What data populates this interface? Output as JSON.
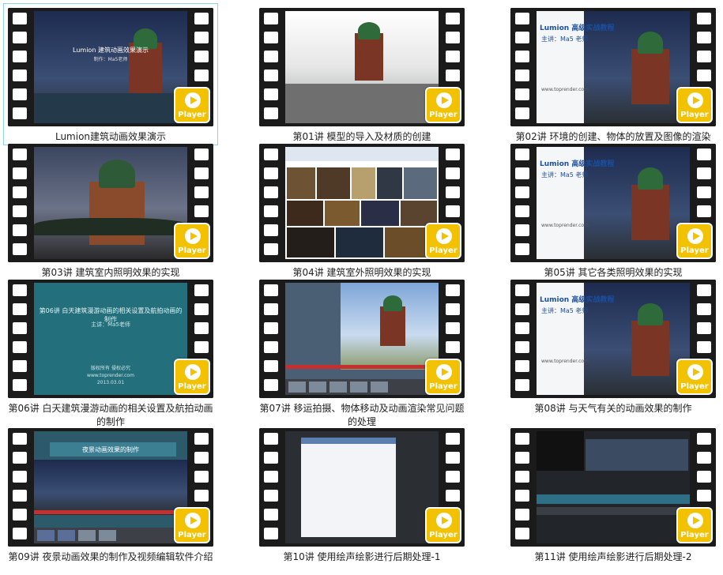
{
  "player_label": "Player",
  "brand_color": "#f2c200",
  "videos": [
    {
      "caption": "Lumion建筑动画效果演示",
      "screen_title": "Lumion 建筑动画效果演示",
      "screen_sub": "制作：Ma5老师"
    },
    {
      "caption": "第01讲 模型的导入及材质的创建"
    },
    {
      "caption": "第02讲 环境的创建、物体的放置及图像的渲染",
      "banner_title": "Lumion 高级实战教程",
      "banner_sub": "主讲：Ma5 老师",
      "banner_url": "www.toprender.com"
    },
    {
      "caption": "第03讲 建筑室内照明效果的实现"
    },
    {
      "caption": "第04讲 建筑室外照明效果的实现"
    },
    {
      "caption": "第05讲 其它各类照明效果的实现",
      "banner_title": "Lumion 高级实战教程",
      "banner_sub": "主讲：Ma5 老师",
      "banner_url": "www.toprender.com"
    },
    {
      "caption": "第06讲 白天建筑漫游动画的相关设置及航拍动画的制作",
      "screen_title": "第06讲 白天建筑漫游动画的相关设置及航拍动画的制作",
      "screen_sub": "主讲：Ma5老师",
      "screen_foot1": "版权所有 侵权必究",
      "screen_foot2": "www.toprender.com",
      "screen_foot3": "2013.03.01"
    },
    {
      "caption": "第07讲 移运拍摄、物体移动及动画渲染常见问题的处理"
    },
    {
      "caption": "第08讲 与天气有关的动画效果的制作",
      "banner_title": "Lumion 高级实战教程",
      "banner_sub": "主讲：Ma5 老师",
      "banner_url": "www.toprender.com"
    },
    {
      "caption": "第09讲 夜景动画效果的制作及视频编辑软件介绍",
      "screen_title": "夜景动画效果的制作"
    },
    {
      "caption": "第10讲 使用绘声绘影进行后期处理-1"
    },
    {
      "caption": "第11讲 使用绘声绘影进行后期处理-2"
    }
  ]
}
